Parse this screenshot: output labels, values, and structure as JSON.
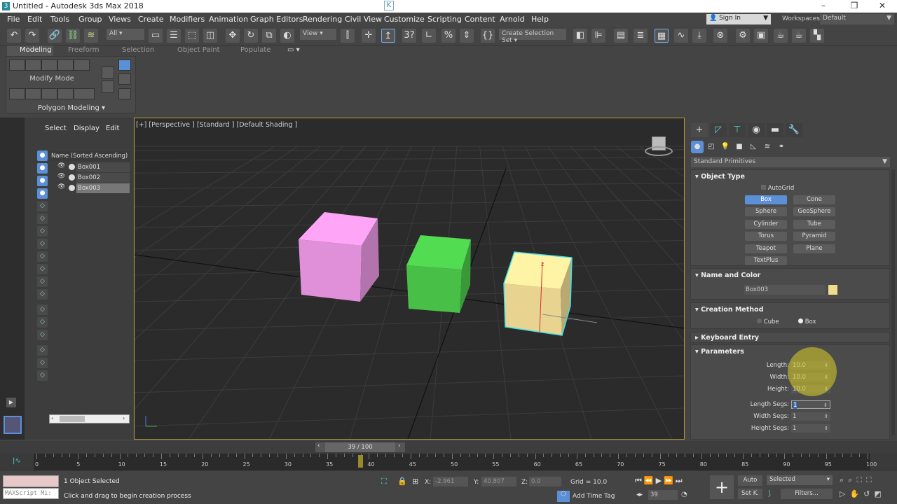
{
  "window": {
    "title": "Untitled - Autodesk 3ds Max 2018",
    "minimize": "–",
    "maximize": "❐",
    "close": "✕",
    "badge": "K"
  },
  "menu": [
    "File",
    "Edit",
    "Tools",
    "Group",
    "Views",
    "Create",
    "Modifiers",
    "Animation",
    "Graph Editors",
    "Rendering",
    "Civil View",
    "Customize",
    "Scripting",
    "Content",
    "Arnold",
    "Help"
  ],
  "account": {
    "sign_in": "Sign In",
    "workspaces_label": "Workspaces:",
    "workspace": "Default"
  },
  "toolbar": {
    "selection_filter": "All",
    "ref_coord": "View",
    "selection_set": "Create Selection Set"
  },
  "ribbon": {
    "tabs": [
      "Modeling",
      "Freeform",
      "Selection",
      "Object Paint",
      "Populate"
    ],
    "active_tab": "Modeling",
    "mode_label": "Modify Mode",
    "panel_label": "Polygon Modeling"
  },
  "explorer": {
    "tabs": [
      "Select",
      "Display",
      "Edit"
    ],
    "column": "Name (Sorted Ascending)",
    "items": [
      "Box001",
      "Box002",
      "Box003"
    ],
    "selected": "Box003"
  },
  "viewport": {
    "label": "[+] [Perspective ] [Standard ] [Default Shading ]",
    "colors": {
      "box001": "#e090d8",
      "box002": "#48c048",
      "box003": "#e8d490",
      "selection": "#40e0e8"
    }
  },
  "cmd": {
    "category": "Standard Primitives",
    "object_type": {
      "title": "Object Type",
      "autogrid": "AutoGrid",
      "buttons": [
        "Box",
        "Cone",
        "Sphere",
        "GeoSphere",
        "Cylinder",
        "Tube",
        "Torus",
        "Pyramid",
        "Teapot",
        "Plane",
        "TextPlus"
      ],
      "active": "Box"
    },
    "name_color": {
      "title": "Name and Color",
      "name": "Box003",
      "color": "#f0dc8c"
    },
    "creation": {
      "title": "Creation Method",
      "options": [
        "Cube",
        "Box"
      ],
      "selected": "Box"
    },
    "keyboard": {
      "title": "Keyboard Entry"
    },
    "params": {
      "title": "Parameters",
      "fields": [
        {
          "label": "Length:",
          "value": "10.0"
        },
        {
          "label": "Width:",
          "value": "10.0"
        },
        {
          "label": "Height:",
          "value": "10.0"
        },
        {
          "label": "Length Segs:",
          "value": "1"
        },
        {
          "label": "Width Segs:",
          "value": "1"
        },
        {
          "label": "Height Segs:",
          "value": "1"
        }
      ]
    }
  },
  "time": {
    "current": 39,
    "total": 100,
    "slider_label": "39 / 100",
    "ticks": [
      "0",
      "5",
      "10",
      "15",
      "20",
      "25",
      "30",
      "35",
      "40",
      "45",
      "50",
      "55",
      "60",
      "65",
      "70",
      "75",
      "80",
      "85",
      "90",
      "95",
      "100"
    ]
  },
  "status": {
    "selected": "1 Object Selected",
    "prompt": "Click and drag to begin creation process",
    "maxscript": "MAXScript Mi:",
    "x_label": "X:",
    "x": "-2.961",
    "y_label": "Y:",
    "y": "40.807",
    "z_label": "Z:",
    "z": "0.0",
    "grid": "Grid = 10.0",
    "add_time_tag": "Add Time Tag",
    "frame": "39",
    "auto": "Auto",
    "setk": "Set K.",
    "key_filter": "Selected",
    "filters": "Filters..."
  }
}
